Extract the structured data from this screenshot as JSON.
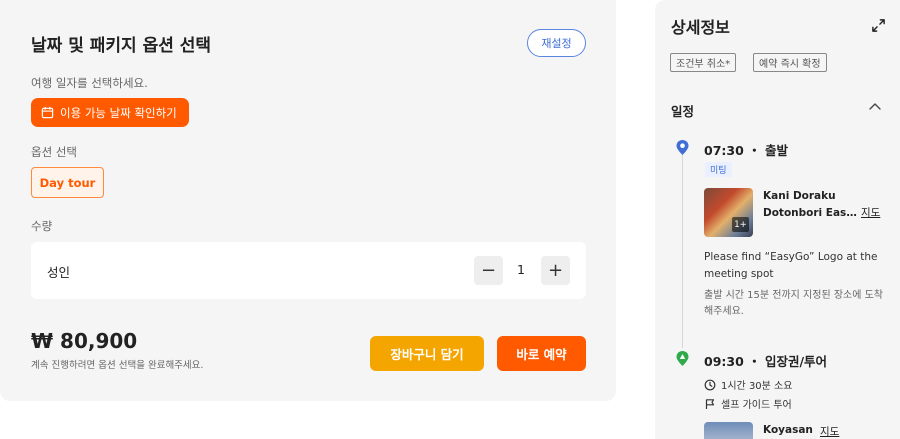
{
  "booking": {
    "title": "날짜 및 패키지 옵션 선택",
    "reset_label": "재설정",
    "date_prompt": "여행 일자를 선택하세요.",
    "date_button_label": "이용 가능 날짜 확인하기",
    "option_label": "옵션 선택",
    "option_chip": "Day tour",
    "quantity_label": "수량",
    "quantity_row": {
      "label": "성인",
      "value": "1",
      "minus": "−",
      "plus": "+"
    },
    "price": "₩ 80,900",
    "price_note": "계속 진행하려면 옵션 선택을 완료해주세요.",
    "cart_button": "장바구니 담기",
    "book_button": "바로 예약",
    "accent_color": "#ff5a00",
    "cart_color": "#f5a500"
  },
  "details": {
    "title": "상세정보",
    "tags": [
      "조건부 취소*",
      "예약 즉시 확정"
    ],
    "schedule_title": "일정",
    "stops": [
      {
        "time_label": "07:30 ・ 출발",
        "badge": "미팅",
        "place_line1": "Kani Doraku",
        "place_line2": "Dotonbori East Branch",
        "photo_count": "1+",
        "map_label": "지도",
        "desc_en": "Please find “EasyGo” Logo at the meeting spot",
        "desc_ko": "출발 시간 15분 전까지 지정된 장소에 도착해주세요."
      },
      {
        "time_label": "09:30 ・ 입장권/투어",
        "duration": "1시간 30분 소요",
        "guide": "셀프 가이드 투어",
        "place": "Koyasan",
        "map_label": "지도"
      }
    ],
    "pin_colors": {
      "start": "#3f6fd6",
      "attraction": "#2eaa4a"
    }
  }
}
